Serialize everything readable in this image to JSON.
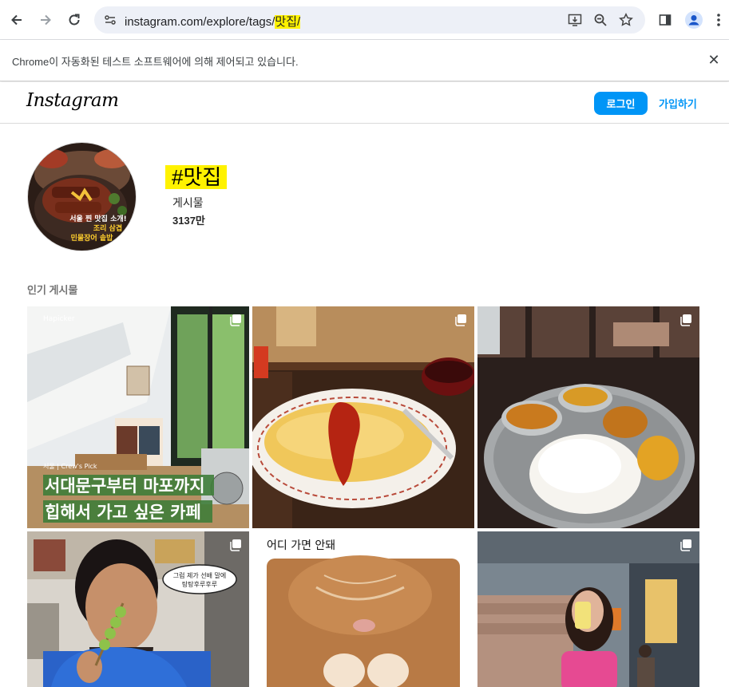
{
  "browser": {
    "url_prefix": "instagram.com/explore/tags/",
    "url_highlight": "맛집/",
    "infobar_text": "Chrome이 자동화된 테스트 소프트웨어에 의해 제어되고 있습니다."
  },
  "header": {
    "logo": "Instagram",
    "login_label": "로그인",
    "signup_label": "가입하기"
  },
  "profile": {
    "hashtag": "#맛집",
    "posts_label": "게시물",
    "posts_count": "3137만",
    "avatar_caption_lines": [
      "서울 찐 맛집 소개!",
      "조리 삼겹",
      "민물장어 솥밥"
    ]
  },
  "section": {
    "popular_label": "인기 게시물"
  },
  "posts": [
    {
      "kind": "cafe",
      "watermark": "Hapicker",
      "small_caption": "서울 | Crew's Pick",
      "caption_line1": "서대문구부터 마포까지",
      "caption_line2": "힙해서 가고 싶은 카페"
    },
    {
      "kind": "omurice"
    },
    {
      "kind": "curry"
    },
    {
      "kind": "person",
      "speech_line1": "그럼 제가 선배 말에",
      "speech_line2": "탕탕후루후루"
    },
    {
      "kind": "cat",
      "title": "어디 가면 안돼"
    },
    {
      "kind": "selfie"
    }
  ],
  "colors": {
    "accent": "#0095f6",
    "highlight": "#fff200",
    "caption_highlight": "#3f7d3a"
  }
}
